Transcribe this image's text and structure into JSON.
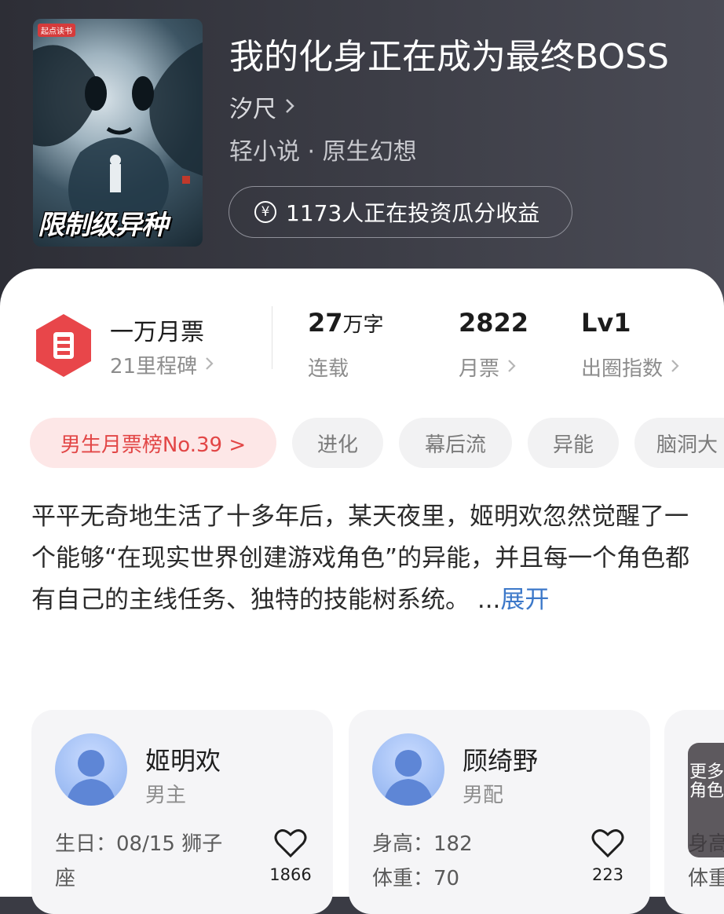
{
  "book": {
    "cover_badge": "起点读书",
    "cover_title": "限制级异种",
    "title": "我的化身正在成为最终BOSS",
    "author": "汐尺",
    "category": "轻小说 · 原生幻想",
    "invest_text": "1173人正在投资瓜分收益"
  },
  "stats": {
    "ticket_main": "一万月票",
    "ticket_sub": "21里程碑",
    "words_value": "27",
    "words_unit": "万字",
    "words_sub": "连载",
    "monthly_value": "2822",
    "monthly_sub": "月票",
    "index_value": "Lv1",
    "index_sub": "出圈指数"
  },
  "tags": [
    "男生月票榜No.39 >",
    "进化",
    "幕后流",
    "异能",
    "脑洞大"
  ],
  "description": {
    "text": "平平无奇地生活了十多年后，某天夜里，姬明欢忽然觉醒了一个能够“在现实世界创建游戏角色”的异能，并且每一个角色都有自己的主线任务、独特的技能树系统。 ...",
    "expand": "展开"
  },
  "characters": [
    {
      "name": "姬明欢",
      "role": "男主",
      "attr1": "生日：08/15 狮子",
      "attr2": "座",
      "likes": "1866"
    },
    {
      "name": "顾绮野",
      "role": "男配",
      "attr1": "身高：182",
      "attr2": "体重：70",
      "likes": "223"
    }
  ],
  "card3": {
    "attr1": "身高",
    "attr2": "体重"
  },
  "more_characters": "更多角色",
  "colors": {
    "accent_red": "#e24646",
    "link_blue": "#3c78c9",
    "header_bg": "#3a3b44"
  }
}
